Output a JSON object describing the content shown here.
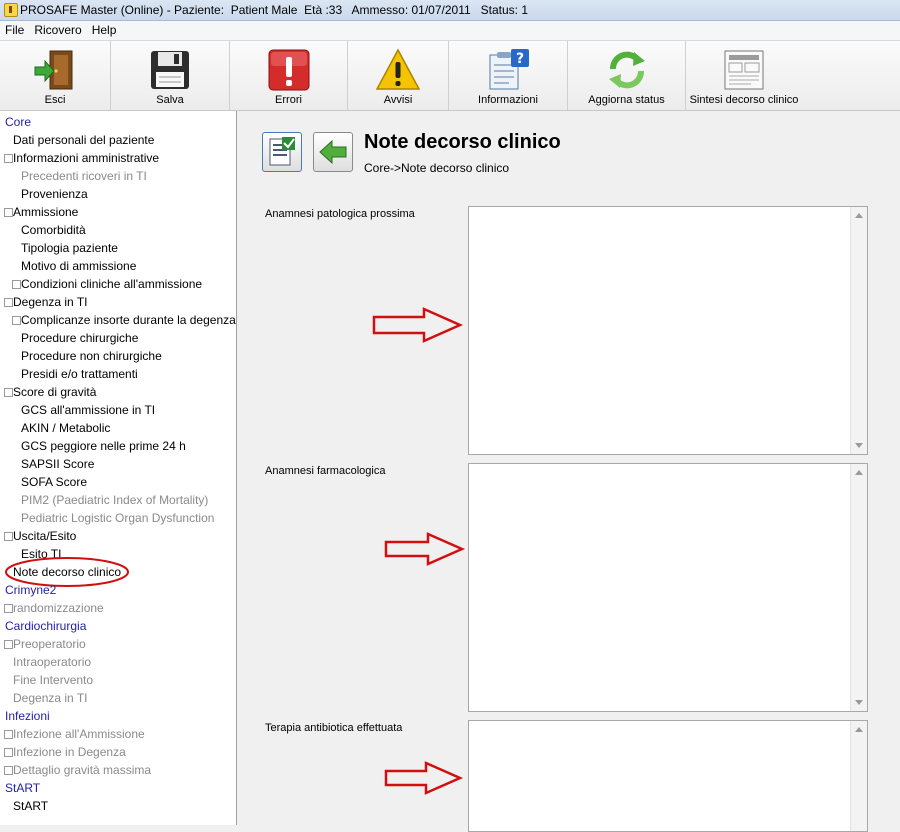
{
  "titlebar": {
    "title": "PROSAFE Master (Online) - Paziente:  Patient Male  Età :33   Ammesso: 01/07/2011   Status: 1"
  },
  "menu": {
    "items": [
      "File",
      "Ricovero",
      "Help"
    ]
  },
  "toolbar": {
    "buttons": [
      {
        "label": "Esci",
        "icon": "exit-door-icon"
      },
      {
        "label": "Salva",
        "icon": "floppy-disk-icon"
      },
      {
        "label": "Errori",
        "icon": "error-exclamation-icon"
      },
      {
        "label": "Avvisi",
        "icon": "warning-triangle-icon"
      },
      {
        "label": "Informazioni",
        "icon": "info-clipboard-icon"
      },
      {
        "label": "Aggiorna status",
        "icon": "refresh-arrows-icon"
      },
      {
        "label": "Sintesi decorso clinico",
        "icon": "report-sheet-icon"
      }
    ]
  },
  "tree": {
    "items": [
      {
        "label": "Core",
        "level": 0,
        "style": "section"
      },
      {
        "label": "Dati personali del paziente",
        "level": 1,
        "style": "normal"
      },
      {
        "label": "Informazioni amministrative",
        "level": 1,
        "style": "normal",
        "expander": true
      },
      {
        "label": "Precedenti ricoveri in TI",
        "level": 2,
        "style": "disabled"
      },
      {
        "label": "Provenienza",
        "level": 2,
        "style": "normal"
      },
      {
        "label": "Ammissione",
        "level": 1,
        "style": "normal",
        "expander": true
      },
      {
        "label": "Comorbidità",
        "level": 2,
        "style": "normal"
      },
      {
        "label": "Tipologia paziente",
        "level": 2,
        "style": "normal"
      },
      {
        "label": "Motivo di ammissione",
        "level": 2,
        "style": "normal"
      },
      {
        "label": "Condizioni cliniche all'ammissione",
        "level": 2,
        "style": "normal",
        "expander": true
      },
      {
        "label": "Degenza in TI",
        "level": 1,
        "style": "normal",
        "expander": true
      },
      {
        "label": "Complicanze insorte durante la degenza",
        "level": 2,
        "style": "normal",
        "expander": true
      },
      {
        "label": "Procedure chirurgiche",
        "level": 2,
        "style": "normal"
      },
      {
        "label": "Procedure non chirurgiche",
        "level": 2,
        "style": "normal"
      },
      {
        "label": "Presidi e/o trattamenti",
        "level": 2,
        "style": "normal"
      },
      {
        "label": "Score di gravità",
        "level": 1,
        "style": "normal",
        "expander": true
      },
      {
        "label": "GCS all'ammissione in TI",
        "level": 2,
        "style": "normal"
      },
      {
        "label": "AKIN / Metabolic",
        "level": 2,
        "style": "normal"
      },
      {
        "label": "GCS peggiore nelle prime 24 h",
        "level": 2,
        "style": "normal"
      },
      {
        "label": "SAPSII Score",
        "level": 2,
        "style": "normal"
      },
      {
        "label": "SOFA Score",
        "level": 2,
        "style": "normal"
      },
      {
        "label": "PIM2 (Paediatric Index of Mortality)",
        "level": 2,
        "style": "disabled"
      },
      {
        "label": "Pediatric Logistic Organ Dysfunction",
        "level": 2,
        "style": "disabled"
      },
      {
        "label": "Uscita/Esito",
        "level": 1,
        "style": "normal",
        "expander": true
      },
      {
        "label": "Esito TI",
        "level": 2,
        "style": "normal"
      },
      {
        "label": "Note decorso clinico",
        "level": 1,
        "style": "normal",
        "selected": true
      },
      {
        "label": "Crimyne2",
        "level": 0,
        "style": "section"
      },
      {
        "label": "randomizzazione",
        "level": 1,
        "style": "disabled",
        "expander": true
      },
      {
        "label": "Cardiochirurgia",
        "level": 0,
        "style": "section"
      },
      {
        "label": "Preoperatorio",
        "level": 1,
        "style": "disabled",
        "expander": true
      },
      {
        "label": "Intraoperatorio",
        "level": 1,
        "style": "disabled"
      },
      {
        "label": "Fine Intervento",
        "level": 1,
        "style": "disabled"
      },
      {
        "label": "Degenza in TI",
        "level": 1,
        "style": "disabled"
      },
      {
        "label": "Infezioni",
        "level": 0,
        "style": "section"
      },
      {
        "label": "Infezione all'Ammissione",
        "level": 1,
        "style": "disabled",
        "expander": true
      },
      {
        "label": "Infezione in Degenza",
        "level": 1,
        "style": "disabled",
        "expander": true
      },
      {
        "label": "Dettaglio gravità massima",
        "level": 1,
        "style": "disabled",
        "expander": true
      },
      {
        "label": "StART",
        "level": 0,
        "style": "section"
      },
      {
        "label": "StART",
        "level": 1,
        "style": "normal"
      }
    ]
  },
  "page": {
    "title": "Note decorso clinico",
    "breadcrumb": "Core->Note decorso clinico"
  },
  "fields": [
    {
      "label": "Anamnesi patologica prossima",
      "value": ""
    },
    {
      "label": "Anamnesi farmacologica",
      "value": ""
    },
    {
      "label": "Terapia antibiotica effettuata",
      "value": ""
    }
  ],
  "colors": {
    "section_text": "#1f1fa6",
    "disabled_text": "#8a8a8a",
    "annotation_red": "#d01010"
  }
}
